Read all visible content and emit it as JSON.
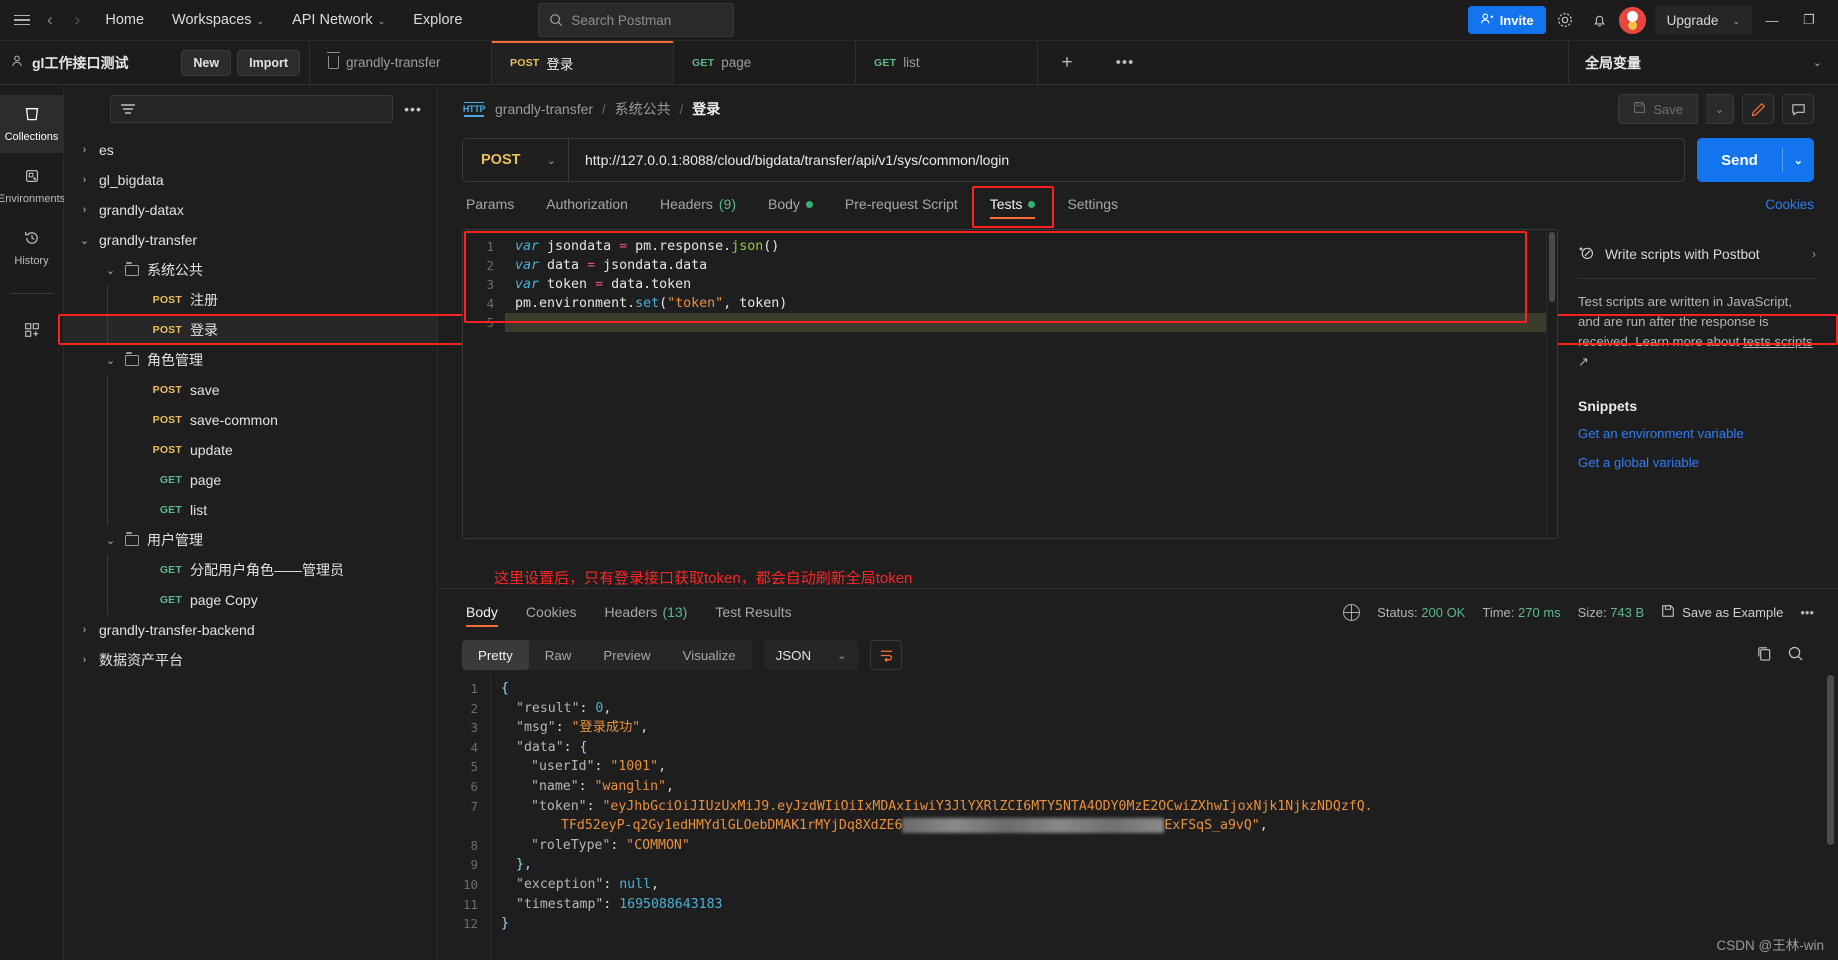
{
  "topbar": {
    "menu_icon": "hamburger-icon",
    "back": "‹",
    "forward": "›",
    "home": "Home",
    "workspaces": "Workspaces",
    "api_network": "API Network",
    "explore": "Explore",
    "search_placeholder": "Search Postman",
    "invite": "Invite",
    "settings_icon": "gear-icon",
    "notifications_icon": "bell-icon",
    "upgrade": "Upgrade",
    "minimize": "—",
    "restore": "❐"
  },
  "workspace": {
    "name": "gl工作接口测试",
    "new_label": "New",
    "import_label": "Import"
  },
  "tabs": [
    {
      "method": "",
      "label": "grandly-transfer",
      "active": false,
      "icon": "collection-icon"
    },
    {
      "method": "POST",
      "label": "登录",
      "active": true
    },
    {
      "method": "GET",
      "label": "page",
      "active": false
    },
    {
      "method": "GET",
      "label": "list",
      "active": false
    }
  ],
  "tabbar": {
    "add": "+",
    "more": "•••"
  },
  "environment": {
    "selected": "全局变量"
  },
  "rail": [
    {
      "label": "Collections",
      "icon": "collections-icon",
      "active": true
    },
    {
      "label": "Environments",
      "icon": "environments-icon",
      "active": false
    },
    {
      "label": "History",
      "icon": "history-icon",
      "active": false
    },
    {
      "label": "",
      "icon": "add-apps-icon",
      "active": false
    }
  ],
  "sidebar": {
    "add_icon": "plus-icon",
    "filter_icon": "filter-icon",
    "more_icon": "more-icon",
    "tree": [
      {
        "depth": 0,
        "chev": "›",
        "kind": "collection",
        "label": "es"
      },
      {
        "depth": 0,
        "chev": "›",
        "kind": "collection",
        "label": "gl_bigdata"
      },
      {
        "depth": 0,
        "chev": "›",
        "kind": "collection",
        "label": "grandly-datax"
      },
      {
        "depth": 0,
        "chev": "⌄",
        "kind": "collection",
        "label": "grandly-transfer"
      },
      {
        "depth": 1,
        "chev": "⌄",
        "kind": "folder",
        "label": "系统公共"
      },
      {
        "depth": 2,
        "chev": "",
        "kind": "request",
        "method": "POST",
        "label": "注册"
      },
      {
        "depth": 2,
        "chev": "",
        "kind": "request",
        "method": "POST",
        "label": "登录",
        "selected": true,
        "highlight": true
      },
      {
        "depth": 1,
        "chev": "⌄",
        "kind": "folder",
        "label": "角色管理"
      },
      {
        "depth": 2,
        "chev": "",
        "kind": "request",
        "method": "POST",
        "label": "save"
      },
      {
        "depth": 2,
        "chev": "",
        "kind": "request",
        "method": "POST",
        "label": "save-common"
      },
      {
        "depth": 2,
        "chev": "",
        "kind": "request",
        "method": "POST",
        "label": "update"
      },
      {
        "depth": 2,
        "chev": "",
        "kind": "request",
        "method": "GET",
        "label": "page"
      },
      {
        "depth": 2,
        "chev": "",
        "kind": "request",
        "method": "GET",
        "label": "list"
      },
      {
        "depth": 1,
        "chev": "⌄",
        "kind": "folder",
        "label": "用户管理"
      },
      {
        "depth": 2,
        "chev": "",
        "kind": "request",
        "method": "GET",
        "label": "分配用户角色——管理员"
      },
      {
        "depth": 2,
        "chev": "",
        "kind": "request",
        "method": "GET",
        "label": "page Copy"
      },
      {
        "depth": 0,
        "chev": "›",
        "kind": "collection",
        "label": "grandly-transfer-backend"
      },
      {
        "depth": 0,
        "chev": "›",
        "kind": "collection",
        "label": "数据资产平台"
      }
    ]
  },
  "request": {
    "protocol_icon": "http-icon",
    "breadcrumb": [
      "grandly-transfer",
      "系统公共",
      "登录"
    ],
    "save_label": "Save",
    "save_caret": "⌄",
    "edit_icon": "pencil-icon",
    "comment_icon": "comment-icon",
    "method": "POST",
    "method_caret": "⌄",
    "url": "http://127.0.0.1:8088/cloud/bigdata/transfer/api/v1/sys/common/login",
    "send_label": "Send",
    "send_caret": "⌄",
    "tabs": [
      {
        "label": "Params"
      },
      {
        "label": "Authorization"
      },
      {
        "label": "Headers",
        "count": "(9)"
      },
      {
        "label": "Body",
        "dot": true
      },
      {
        "label": "Pre-request Script"
      },
      {
        "label": "Tests",
        "dot": true,
        "active": true,
        "highlight": true
      },
      {
        "label": "Settings"
      }
    ],
    "cookies_link": "Cookies"
  },
  "script": {
    "line_numbers": [
      "1",
      "2",
      "3",
      "4",
      "5"
    ],
    "lines": [
      "var jsondata = pm.response.json()",
      "var data = jsondata.data",
      "var token = data.token",
      "pm.environment.set(\"token\", token)",
      ""
    ],
    "annotation": "这里设置后，只有登录接口获取token，都会自动刷新全局token"
  },
  "right_panel": {
    "postbot_icon": "postbot-icon",
    "postbot_label": "Write scripts with Postbot",
    "postbot_arrow": "›",
    "description_1": "Test scripts are written in JavaScript, and are run after the response is received.",
    "learn_prefix": "Learn more about ",
    "learn_link": "tests scripts",
    "learn_suffix": " ↗",
    "snippets_title": "Snippets",
    "snippets": [
      "Get an environment variable",
      "Get a global variable"
    ]
  },
  "response": {
    "tabs": [
      {
        "label": "Body",
        "active": true
      },
      {
        "label": "Cookies"
      },
      {
        "label": "Headers",
        "count": "(13)"
      },
      {
        "label": "Test Results"
      }
    ],
    "globe_icon": "globe-icon",
    "status_label": "Status:",
    "status_value": "200 OK",
    "time_label": "Time:",
    "time_value": "270 ms",
    "size_label": "Size:",
    "size_value": "743 B",
    "save_example_icon": "save-icon",
    "save_example": "Save as Example",
    "more": "•••",
    "view_modes": [
      "Pretty",
      "Raw",
      "Preview",
      "Visualize"
    ],
    "view_active": "Pretty",
    "format": "JSON",
    "format_caret": "⌄",
    "wrap_icon": "wrap-lines-icon",
    "copy_icon": "copy-icon",
    "search_icon": "search-icon",
    "line_numbers": [
      "1",
      "2",
      "3",
      "4",
      "5",
      "6",
      "7",
      "",
      "8",
      "9",
      "10",
      "11",
      "12"
    ],
    "body_lines": [
      {
        "indent": 0,
        "segments": [
          {
            "t": "{",
            "c": "j-brace"
          }
        ]
      },
      {
        "indent": 1,
        "segments": [
          {
            "t": "\"result\"",
            "c": "j-key"
          },
          {
            "t": ": ",
            "c": ""
          },
          {
            "t": "0",
            "c": "j-num"
          },
          {
            "t": ",",
            "c": ""
          }
        ]
      },
      {
        "indent": 1,
        "segments": [
          {
            "t": "\"msg\"",
            "c": "j-key"
          },
          {
            "t": ": ",
            "c": ""
          },
          {
            "t": "\"登录成功\"",
            "c": "j-str"
          },
          {
            "t": ",",
            "c": ""
          }
        ]
      },
      {
        "indent": 1,
        "segments": [
          {
            "t": "\"data\"",
            "c": "j-key"
          },
          {
            "t": ": ",
            "c": ""
          },
          {
            "t": "{",
            "c": "j-brace"
          }
        ]
      },
      {
        "indent": 2,
        "segments": [
          {
            "t": "\"userId\"",
            "c": "j-key"
          },
          {
            "t": ": ",
            "c": ""
          },
          {
            "t": "\"1001\"",
            "c": "j-str"
          },
          {
            "t": ",",
            "c": ""
          }
        ]
      },
      {
        "indent": 2,
        "segments": [
          {
            "t": "\"name\"",
            "c": "j-key"
          },
          {
            "t": ": ",
            "c": ""
          },
          {
            "t": "\"wanglin\"",
            "c": "j-str"
          },
          {
            "t": ",",
            "c": ""
          }
        ]
      },
      {
        "indent": 2,
        "segments": [
          {
            "t": "\"token\"",
            "c": "j-key"
          },
          {
            "t": ": ",
            "c": ""
          },
          {
            "t": "\"eyJhbGciOiJIUzUxMiJ9.eyJzdWIiOiIxMDAxIiwiY3JlYXRlZCI6MTY5NTA4ODY0MzE2OCwiZXhwIjoxNjk1NjkzNDQzfQ.",
            "c": "j-str"
          }
        ]
      },
      {
        "indent": 4,
        "segments": [
          {
            "t": "TFd52eyP-q2Gy1edHMYdlGLOebDMAK1rMYjDq8XdZE6",
            "c": "j-str"
          },
          {
            "t": " blur1 ",
            "c": "blur"
          },
          {
            "t": "ExFSqS_a9vQ\"",
            "c": "j-str"
          },
          {
            "t": ",",
            "c": ""
          }
        ]
      },
      {
        "indent": 2,
        "segments": [
          {
            "t": "\"roleType\"",
            "c": "j-key"
          },
          {
            "t": ": ",
            "c": ""
          },
          {
            "t": "\"COMMON\"",
            "c": "j-str"
          }
        ]
      },
      {
        "indent": 1,
        "segments": [
          {
            "t": "},",
            "c": "j-brace"
          }
        ]
      },
      {
        "indent": 1,
        "segments": [
          {
            "t": "\"exception\"",
            "c": "j-key"
          },
          {
            "t": ": ",
            "c": ""
          },
          {
            "t": "null",
            "c": "j-null"
          },
          {
            "t": ",",
            "c": ""
          }
        ]
      },
      {
        "indent": 1,
        "segments": [
          {
            "t": "\"timestamp\"",
            "c": "j-key"
          },
          {
            "t": ": ",
            "c": ""
          },
          {
            "t": "1695088643183",
            "c": "j-num"
          }
        ]
      },
      {
        "indent": 0,
        "segments": [
          {
            "t": "}",
            "c": "j-brace"
          }
        ]
      }
    ]
  },
  "watermark": "CSDN @王林-win"
}
